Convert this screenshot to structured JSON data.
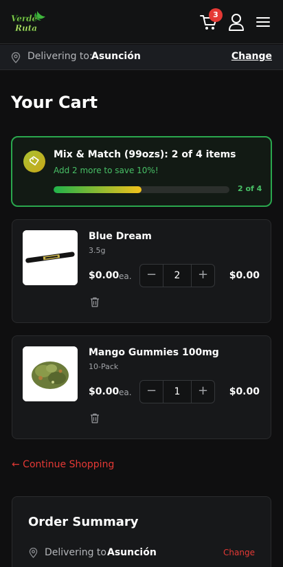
{
  "header": {
    "logo_line1": "Verde",
    "logo_line2": "Ruta",
    "cart_count": "3",
    "icons": [
      "cart-icon",
      "user-icon",
      "menu-icon"
    ]
  },
  "delivery_bar": {
    "label": "Delivering to:",
    "city": "Asunción",
    "change_label": "Change",
    "icon": "location-pin-icon"
  },
  "page_title": "Your Cart",
  "promo": {
    "title": "Mix & Match (99ozs): 2 of 4 items",
    "subtitle": "Add 2 more to save 10%!",
    "progress_label": "2 of 4",
    "progress_fraction": 0.5,
    "icon": "tag-icon",
    "colors": {
      "border": "#2aa84e",
      "accent": "#48c066",
      "fill_start": "#20b34a",
      "fill_end": "#f2c21b"
    }
  },
  "items": [
    {
      "name": "Blue Dream",
      "size": "3.5g",
      "price": "$0.00",
      "unit": "ea.",
      "quantity": "2",
      "total": "$0.00"
    },
    {
      "name": "Mango Gummies 100mg",
      "size": "10-Pack",
      "price": "$0.00",
      "unit": "ea.",
      "quantity": "1",
      "total": "$0.00"
    }
  ],
  "stepper": {
    "minus": "−",
    "plus": "+"
  },
  "continue_label": "← Continue Shopping",
  "summary": {
    "title": "Order Summary",
    "label": "Delivering to",
    "city": "Asunción",
    "change_label": "Change"
  },
  "colors": {
    "brand_red": "#e53935",
    "background": "#0f0f10"
  }
}
